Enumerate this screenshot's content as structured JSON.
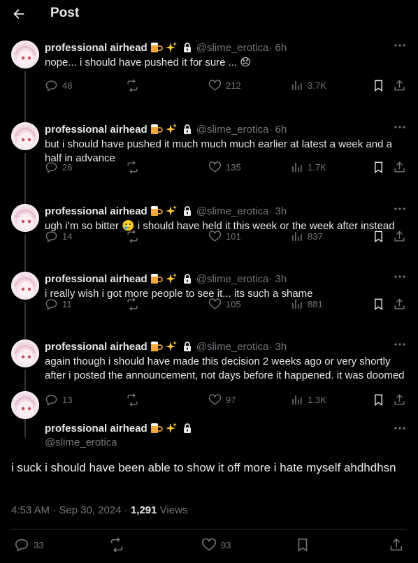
{
  "header": {
    "title": "Post"
  },
  "author": {
    "name": "professional airhead",
    "handle": "@slime_erotica"
  },
  "thread": [
    {
      "time": "6h",
      "text": "nope... i should have pushed it for sure ... 😞",
      "replies": "48",
      "likes": "212",
      "views": "3.7K"
    },
    {
      "time": "6h",
      "text": "but i should have pushed it much much much earlier at latest a week and a half in advance",
      "replies": "26",
      "likes": "135",
      "views": "1.7K"
    },
    {
      "time": "3h",
      "text": "ugh i’m so bitter 🥲 i should have held it this week or the week after instead",
      "replies": "14",
      "likes": "101",
      "views": "837"
    },
    {
      "time": "3h",
      "text": "i really wish i got more people to see it... its such a shame",
      "replies": "11",
      "likes": "105",
      "views": "881"
    },
    {
      "time": "3h",
      "text": "again though i should have made this decision 2 weeks ago or very shortly after i posted the announcement, not days before it happened. it was doomed",
      "replies": "13",
      "likes": "97",
      "views": "1.3K"
    }
  ],
  "main": {
    "text": "i suck i should have been able to show it off more i hate myself ahdhdhsn",
    "timestamp": "4:53 AM · Sep 30, 2024 · ",
    "views_count": "1,291",
    "views_label": "Views",
    "replies": "33",
    "likes": "93"
  },
  "colors": {
    "background": "#000000",
    "text": "#e7e9ea",
    "muted": "#71767b",
    "divider": "#2f3336"
  }
}
